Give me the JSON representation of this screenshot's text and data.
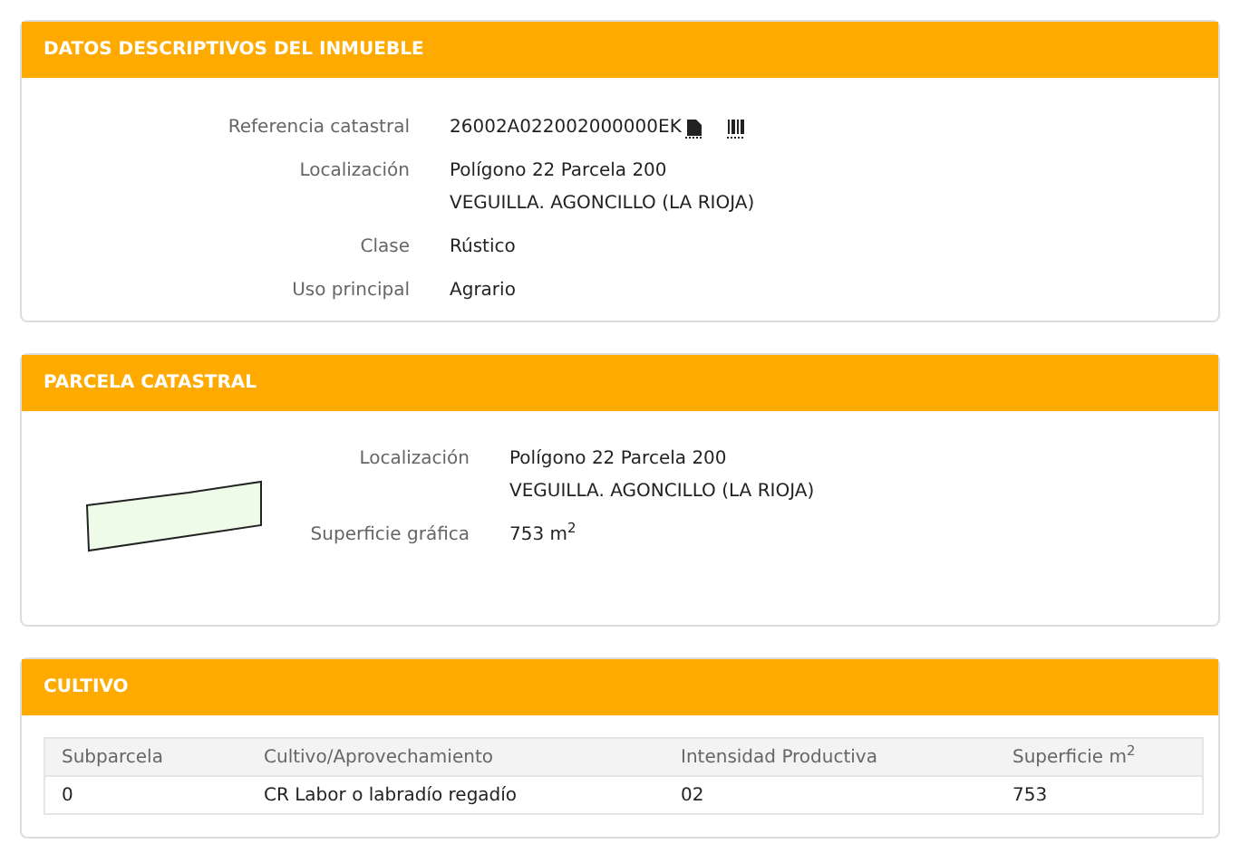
{
  "datos": {
    "title": "DATOS DESCRIPTIVOS DEL INMUEBLE",
    "fields": [
      {
        "label": "Referencia catastral",
        "lines": [
          "26002A022002000000EK"
        ],
        "kind": "reference"
      },
      {
        "label": "Localización",
        "lines": [
          "Polígono 22 Parcela 200",
          "VEGUILLA. AGONCILLO (LA RIOJA)"
        ],
        "kind": "text"
      },
      {
        "label": "Clase",
        "lines": [
          "Rústico"
        ],
        "kind": "text"
      },
      {
        "label": "Uso principal",
        "lines": [
          "Agrario"
        ],
        "kind": "text"
      }
    ]
  },
  "parcela": {
    "title": "PARCELA CATASTRAL",
    "fields": [
      {
        "label": "Localización",
        "lines": [
          "Polígono 22 Parcela 200",
          "VEGUILLA. AGONCILLO (LA RIOJA)"
        ]
      },
      {
        "label": "Superficie gráfica",
        "lines": [
          "753 m$^{2}$"
        ]
      }
    ]
  },
  "cultivo": {
    "title": "CULTIVO",
    "columns": [
      "Subparcela",
      "Cultivo/Aprovechamiento",
      "Intensidad Productiva",
      "Superficie m$^{2}$"
    ],
    "rows": [
      [
        "0",
        "CR Labor o labradío regadío",
        "02",
        "753"
      ]
    ]
  }
}
